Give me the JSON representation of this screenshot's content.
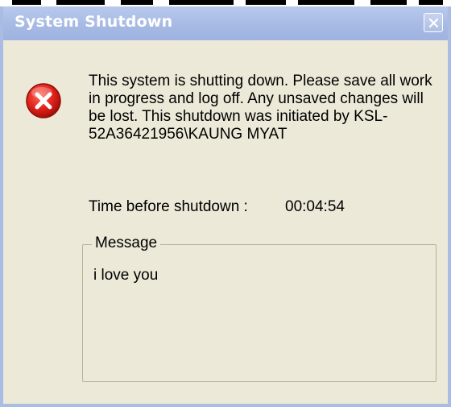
{
  "window": {
    "title": "System Shutdown"
  },
  "icons": {
    "dialog_icon": "error-icon",
    "close": "close-icon"
  },
  "dialog": {
    "message": "This system is shutting down. Please save all work in progress and log off. Any unsaved changes will be lost. This shutdown was initiated by KSL-52A36421956\\KAUNG MYAT",
    "timer_label": "Time before shutdown :",
    "timer_value": "00:04:54",
    "message_group_label": "Message",
    "message_text": "i love you"
  },
  "colors": {
    "titlebar": "#a6b9e3",
    "window_background": "#ece9d8",
    "error_red": "#e0231b"
  }
}
